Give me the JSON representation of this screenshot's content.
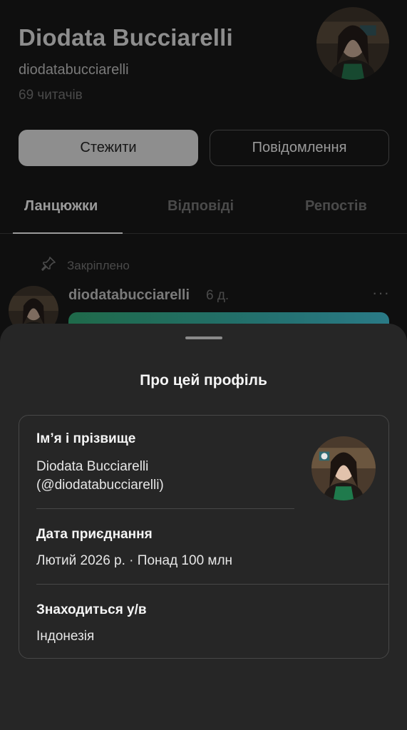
{
  "profile": {
    "display_name": "Diodata Bucciarelli",
    "username": "diodatabucciarelli",
    "followers": "69 читачів"
  },
  "actions": {
    "follow_label": "Стежити",
    "message_label": "Повідомлення"
  },
  "tabs": [
    {
      "label": "Ланцюжки"
    },
    {
      "label": "Відповіді"
    },
    {
      "label": "Репостів"
    }
  ],
  "pinned_post": {
    "pinned_label": "Закріплено",
    "username": "diodatabucciarelli",
    "time": "6 д.",
    "more_label": "···"
  },
  "about_sheet": {
    "title": "Про цей профіль",
    "name_label": "Ім’я і прізвище",
    "name_value": "Diodata Bucciarelli",
    "handle_value": "(@diodatabucciarelli)",
    "joined_label": "Дата приєднання",
    "joined_value": "Лютий 2026 р. · Понад 100 млн",
    "location_label": "Знаходиться у/в",
    "location_value": "Індонезія"
  },
  "icons": {
    "pin": "pin-icon",
    "more": "more-dots-icon"
  },
  "colors": {
    "background": "#0f0f0f",
    "sheet": "#262626",
    "accent_green": "#1f6a4a"
  }
}
